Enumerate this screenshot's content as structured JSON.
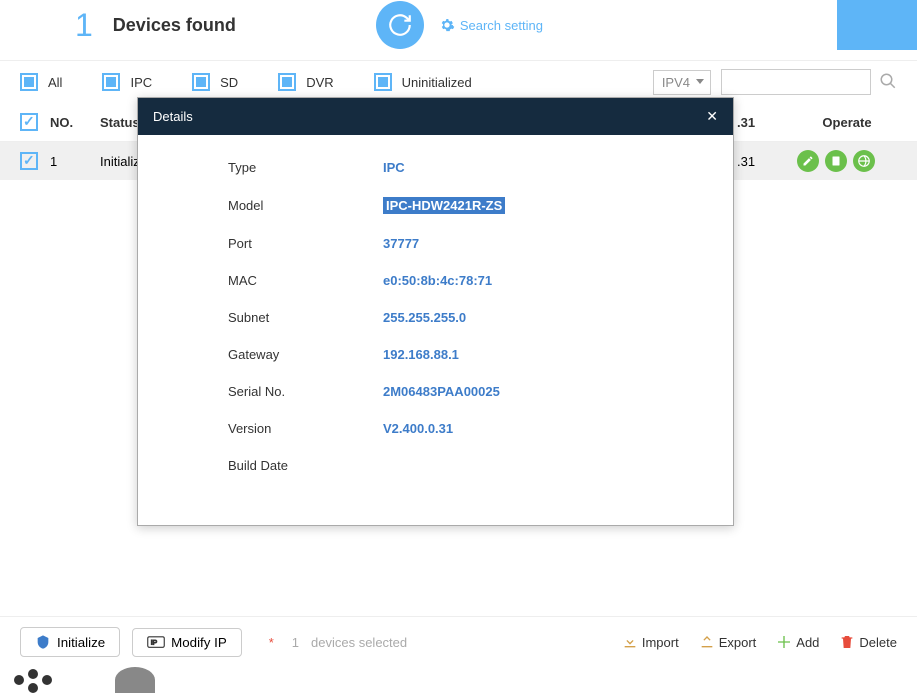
{
  "header": {
    "count": "1",
    "title": "Devices found",
    "search_setting": "Search setting"
  },
  "filters": {
    "all": "All",
    "ipc": "IPC",
    "sd": "SD",
    "dvr": "DVR",
    "uninit": "Uninitialized",
    "ipv": "IPV4"
  },
  "columns": {
    "no": "NO.",
    "status": "Status",
    "end_col": ".31",
    "operate": "Operate"
  },
  "row": {
    "no": "1",
    "status": "Initialized"
  },
  "modal": {
    "title": "Details",
    "labels": {
      "type": "Type",
      "model": "Model",
      "port": "Port",
      "mac": "MAC",
      "subnet": "Subnet",
      "gateway": "Gateway",
      "serial": "Serial No.",
      "version": "Version",
      "build": "Build Date"
    },
    "values": {
      "type": "IPC",
      "model": "IPC-HDW2421R-ZS",
      "port": "37777",
      "mac": "e0:50:8b:4c:78:71",
      "subnet": "255.255.255.0",
      "gateway": "192.168.88.1",
      "serial": "2M06483PAA00025",
      "version": "V2.400.0.31",
      "build": ""
    }
  },
  "footer": {
    "initialize": "Initialize",
    "modify": "Modify IP",
    "selected_count": "1",
    "selected_text": "devices selected",
    "import": "Import",
    "export": "Export",
    "add": "Add",
    "delete": "Delete"
  }
}
